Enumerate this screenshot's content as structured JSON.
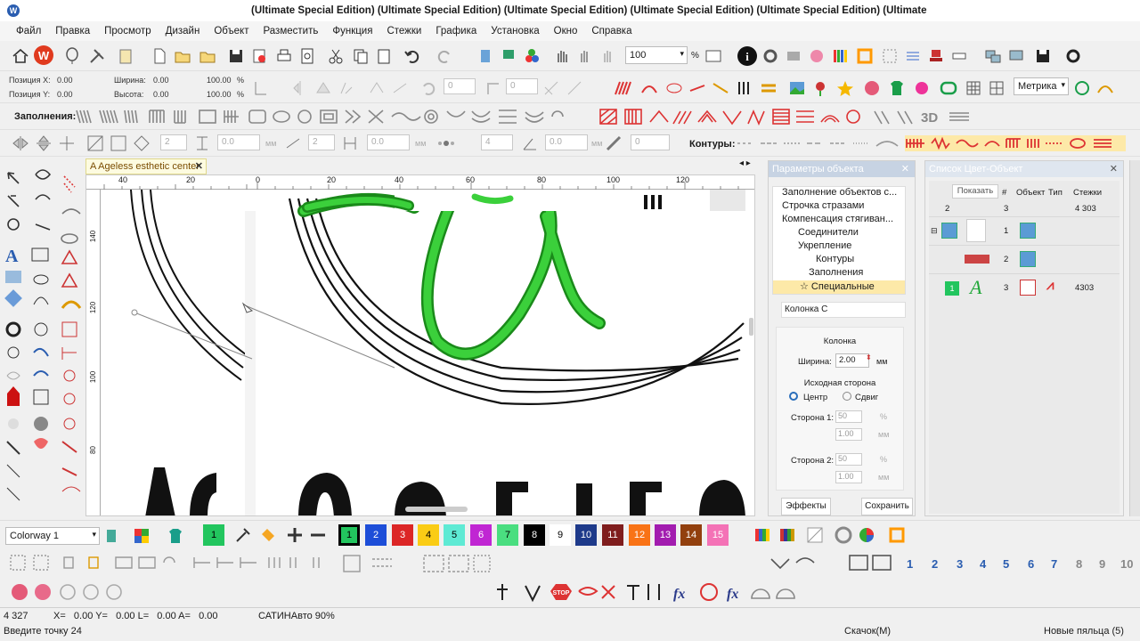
{
  "window": {
    "title": "(Ultimate Special Edition) (Ultimate Special Edition) (Ultimate Special Edition) (Ultimate Special Edition) (Ultimate Special Edition) (Ultimate Special Editi"
  },
  "menu": [
    "Файл",
    "Правка",
    "Просмотр",
    "Дизайн",
    "Объект",
    "Разместить",
    "Функция",
    "Стежки",
    "Графика",
    "Установка",
    "Окно",
    "Справка"
  ],
  "toolbar": {
    "zoom_value": "100",
    "zoom_unit": "%",
    "units_dropdown": "Метрика"
  },
  "position_fields": {
    "pos_x_label": "Позиция X:",
    "pos_x": "0.00",
    "pos_y_label": "Позиция Y:",
    "pos_y": "0.00",
    "width_label": "Ширина:",
    "width": "0.00",
    "width_pct": "100.00",
    "width_pct_unit": "%",
    "height_label": "Высота:",
    "height": "0.00",
    "height_pct": "100.00",
    "height_pct_unit": "%",
    "rot_a": "0",
    "rot_b": "0"
  },
  "fills_label": "Заполнения:",
  "contours_label": "Контуры:",
  "row4": {
    "v1": "2",
    "v2": "0.0",
    "v3": "2",
    "v4": "0.0",
    "v5": "4",
    "v6": "0.0",
    "v7": "0",
    "unit": "мм"
  },
  "document_tab": {
    "label": "A Ageless esthetic center"
  },
  "canvas": {
    "ruler_h": [
      "40",
      "20",
      "0",
      "20",
      "40",
      "60",
      "80",
      "100",
      "120"
    ],
    "ruler_v": [
      "140",
      "120",
      "100",
      "80"
    ],
    "bottom_text": "AGELESS"
  },
  "object_params": {
    "title": "Параметры объекта",
    "tree": [
      "Заполнение объектов с...",
      "Строчка стразами",
      "Компенсация стягиван...",
      "Соединители",
      "Укрепление",
      "Контуры",
      "Заполнения",
      "Специальные"
    ],
    "stitch_type": "Колонка С",
    "group_label": "Колонка",
    "width_label": "Ширина:",
    "width_value": "2.00",
    "width_unit": "мм",
    "source_side_label": "Исходная сторона",
    "radio_center": "Центр",
    "radio_shift": "Сдвиг",
    "side1_label": "Сторона 1:",
    "side1_pct": "50",
    "side1_mm": "1.00",
    "side2_label": "Сторона 2:",
    "side2_pct": "50",
    "side2_mm": "1.00",
    "pct": "%",
    "mm": "мм",
    "effects_btn": "Эффекты",
    "save_btn": "Сохранить"
  },
  "color_object_list": {
    "title": "Список Цвет-Объект",
    "show_btn": "Показать",
    "col_num": "#",
    "col_object": "Объект",
    "col_type": "Тип",
    "col_stitches": "Стежки",
    "top_a": "2",
    "top_b": "3",
    "top_stitches": "4 303",
    "rows": [
      {
        "num": "1",
        "stitches": ""
      },
      {
        "num": "2",
        "stitches": ""
      },
      {
        "color_num": "1",
        "num": "3",
        "stitches": "4303"
      }
    ]
  },
  "colorway": {
    "label": "Colorway 1",
    "swatches": [
      "1",
      "2",
      "3",
      "4",
      "5",
      "6",
      "7",
      "8",
      "9",
      "10",
      "11",
      "12",
      "13",
      "14",
      "15"
    ],
    "first_swatch": "1"
  },
  "hoop_numbers": [
    "1",
    "2",
    "3",
    "4",
    "5",
    "6",
    "7",
    "8",
    "9",
    "10"
  ],
  "status": {
    "stitch_count": "4 327",
    "coords": "X=   0.00 Y=   0.00 L=   0.00 A=   0.00",
    "mode": "САТИНАвто 90%",
    "prompt": "Введите точку 24",
    "jump": "Скачок(М)",
    "hoop": "Новые пяльца (5)"
  },
  "colors": {
    "accent_green": "#2ecc40",
    "swatch_1": "#22c55e",
    "swatch_2": "#1d4ed8",
    "swatch_3": "#dc2626",
    "swatch_4": "#facc15",
    "swatch_5": "#5eead4",
    "swatch_6": "#c026d3",
    "swatch_7": "#4ade80",
    "swatch_8": "#000000",
    "swatch_9": "#ffffff",
    "swatch_10": "#1e3a8a",
    "swatch_11": "#7f1d1d",
    "swatch_12": "#f97316",
    "swatch_13": "#a21caf",
    "swatch_14": "#92400e",
    "swatch_15": "#f472b6"
  }
}
